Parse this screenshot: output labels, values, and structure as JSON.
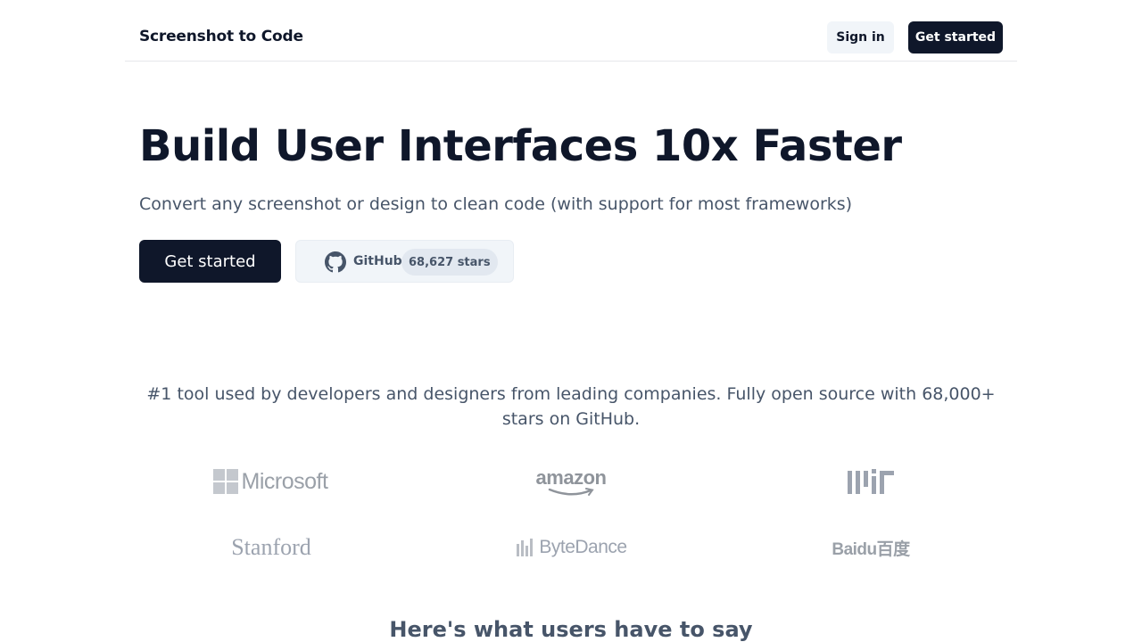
{
  "nav": {
    "brand": "Screenshot to Code",
    "sign_in": "Sign in",
    "get_started": "Get started"
  },
  "hero": {
    "title": "Build User Interfaces 10x Faster",
    "subtitle": "Convert any screenshot or design to clean code (with support for most frameworks)",
    "cta": "Get started",
    "github_label": "GitHub",
    "github_stars": "68,627 stars",
    "github_icon": "github-icon"
  },
  "social_proof": {
    "text": "#1 tool used by developers and designers from leading companies. Fully open source with 68,000+ stars on GitHub."
  },
  "logos": {
    "microsoft": "Microsoft",
    "amazon": "amazon",
    "mit": "MIT",
    "stanford": "Stanford",
    "bytedance": "ByteDance",
    "baidu": "Baidu百度"
  },
  "testimonials": {
    "title": "Here's what users have to say"
  },
  "colors": {
    "primary": "#0f172a",
    "muted_text": "#475569",
    "secondary_bg": "#f1f5f9",
    "logo_gray": "#9ca3af"
  }
}
